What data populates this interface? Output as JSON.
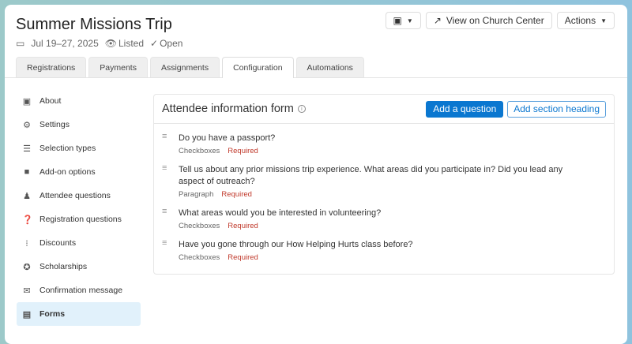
{
  "header": {
    "title": "Summer Missions Trip",
    "date": "Jul 19–27, 2025",
    "listed": "Listed",
    "open": "Open",
    "view_label": "View on Church Center",
    "actions_label": "Actions"
  },
  "tabs": [
    "Registrations",
    "Payments",
    "Assignments",
    "Configuration",
    "Automations"
  ],
  "sidebar": [
    {
      "label": "About",
      "icon": "calendar-icon"
    },
    {
      "label": "Settings",
      "icon": "gear-icon"
    },
    {
      "label": "Selection types",
      "icon": "list-icon"
    },
    {
      "label": "Add-on options",
      "icon": "addon-icon"
    },
    {
      "label": "Attendee questions",
      "icon": "person-question-icon"
    },
    {
      "label": "Registration questions",
      "icon": "question-circle-icon"
    },
    {
      "label": "Discounts",
      "icon": "discount-icon"
    },
    {
      "label": "Scholarships",
      "icon": "ribbon-icon"
    },
    {
      "label": "Confirmation message",
      "icon": "envelope-icon"
    },
    {
      "label": "Forms",
      "icon": "forms-icon"
    }
  ],
  "form": {
    "title": "Attendee information form",
    "add_question": "Add a question",
    "add_heading": "Add section heading",
    "questions": [
      {
        "text": "Do you have a passport?",
        "type": "Checkboxes",
        "required": "Required"
      },
      {
        "text": "Tell us about any prior missions trip experience. What areas did you participate in? Did you lead any aspect of outreach?",
        "type": "Paragraph",
        "required": "Required"
      },
      {
        "text": "What areas would you be interested in volunteering?",
        "type": "Checkboxes",
        "required": "Required"
      },
      {
        "text": "Have you gone through our How Helping Hurts class before?",
        "type": "Checkboxes",
        "required": "Required"
      }
    ]
  }
}
